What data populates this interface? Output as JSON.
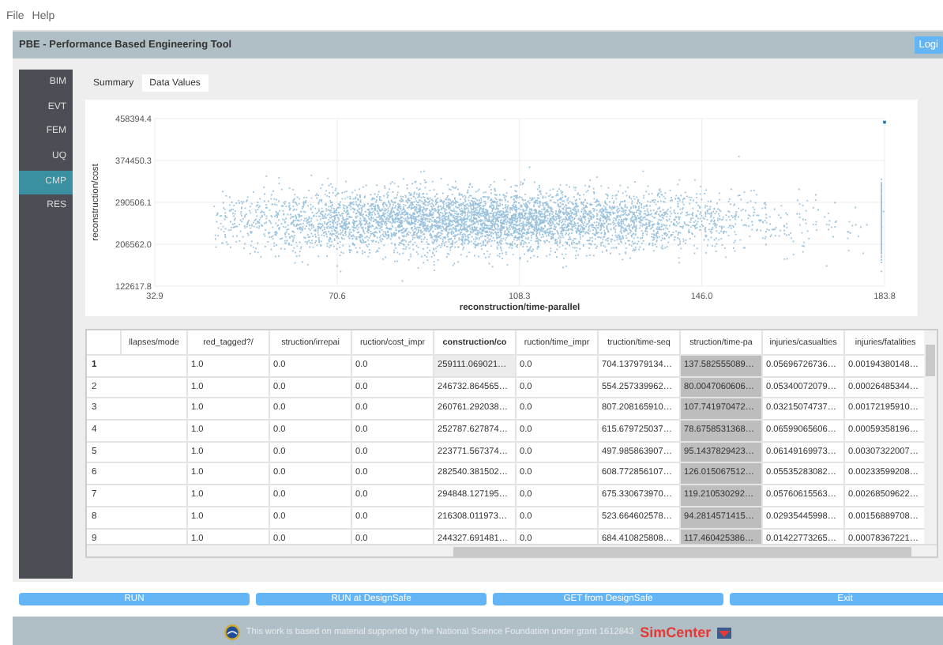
{
  "menu": [
    "File",
    "Help"
  ],
  "window": {
    "title": "PBE - Performance Based Engineering Tool",
    "login_button": "Logi"
  },
  "sidebar": {
    "items": [
      {
        "label": "BIM",
        "selected": false
      },
      {
        "label": "EVT",
        "selected": false
      },
      {
        "label": "FEM",
        "selected": false
      },
      {
        "label": "UQ",
        "selected": false
      },
      {
        "label": "CMP",
        "selected": true
      },
      {
        "label": "RES",
        "selected": false
      }
    ]
  },
  "tabs": [
    {
      "label": "Summary",
      "selected": false
    },
    {
      "label": "Data Values",
      "selected": true
    }
  ],
  "chart": {
    "chart_data": {
      "type": "scatter",
      "grid": true,
      "xlabel": "reconstruction/time-parallel",
      "ylabel": "reconstruction/cost",
      "xlim": [
        32.9,
        183.8
      ],
      "ylim": [
        122617.8,
        458394.4
      ],
      "xticks": [
        {
          "value": 32.9,
          "label": "32.9"
        },
        {
          "value": 70.6,
          "label": "70.6"
        },
        {
          "value": 108.3,
          "label": "108.3"
        },
        {
          "value": 146.0,
          "label": "146.0"
        },
        {
          "value": 183.8,
          "label": "183.8"
        }
      ],
      "yticks": [
        {
          "value": 122617.8,
          "label": "122617.8"
        },
        {
          "value": 206562.0,
          "label": "206562.0"
        },
        {
          "value": 290506.1,
          "label": "290506.1"
        },
        {
          "value": 374450.3,
          "label": "374450.3"
        },
        {
          "value": 458394.4,
          "label": "458394.4"
        }
      ]
    }
  },
  "table": {
    "columns": [
      {
        "label": "llapses/mode",
        "current": false,
        "selected": false
      },
      {
        "label": "red_tagged?/",
        "current": false,
        "selected": false
      },
      {
        "label": "struction/irrepai",
        "current": false,
        "selected": false
      },
      {
        "label": "ruction/cost_impr",
        "current": false,
        "selected": false
      },
      {
        "label": "construction/co",
        "current": true,
        "selected": false
      },
      {
        "label": "ruction/time_impr",
        "current": false,
        "selected": false
      },
      {
        "label": "truction/time-seq",
        "current": false,
        "selected": false
      },
      {
        "label": "struction/time-pa",
        "current": false,
        "selected": true
      },
      {
        "label": "injuries/casualties",
        "current": false,
        "selected": false
      },
      {
        "label": "injuries/fatalities",
        "current": false,
        "selected": false
      }
    ],
    "rows": [
      {
        "header": "1",
        "current": true,
        "cells": [
          "",
          "1.0",
          "0.0",
          "0.0",
          "259111.069021…",
          "0.0",
          "704.137979134…",
          "137.582555089…",
          "0.05696726736…",
          "0.00194380148…"
        ]
      },
      {
        "header": "2",
        "current": false,
        "cells": [
          "",
          "1.0",
          "0.0",
          "0.0",
          "246732.864565…",
          "0.0",
          "554.257339962…",
          "80.0047060606…",
          "0.05340072079…",
          "0.00026485344…"
        ]
      },
      {
        "header": "3",
        "current": false,
        "cells": [
          "",
          "1.0",
          "0.0",
          "0.0",
          "260761.292038…",
          "0.0",
          "807.208165910…",
          "107.741970472…",
          "0.03215074737…",
          "0.00172195910…"
        ]
      },
      {
        "header": "4",
        "current": false,
        "cells": [
          "",
          "1.0",
          "0.0",
          "0.0",
          "252787.627874…",
          "0.0",
          "615.679725037…",
          "78.6758531368…",
          "0.06599065606…",
          "0.00059358196…"
        ]
      },
      {
        "header": "5",
        "current": false,
        "cells": [
          "",
          "1.0",
          "0.0",
          "0.0",
          "223771.567374…",
          "0.0",
          "497.985863907…",
          "95.1437829423…",
          "0.06149169973…",
          "0.00307322007…"
        ]
      },
      {
        "header": "6",
        "current": false,
        "cells": [
          "",
          "1.0",
          "0.0",
          "0.0",
          "282540.381502…",
          "0.0",
          "608.772856107…",
          "126.015067512…",
          "0.05535283082…",
          "0.00233599208…"
        ]
      },
      {
        "header": "7",
        "current": false,
        "cells": [
          "",
          "1.0",
          "0.0",
          "0.0",
          "294848.127195…",
          "0.0",
          "675.330673970…",
          "119.210530292…",
          "0.05760615563…",
          "0.00268509622…"
        ]
      },
      {
        "header": "8",
        "current": false,
        "cells": [
          "",
          "1.0",
          "0.0",
          "0.0",
          "216308.011973…",
          "0.0",
          "523.664602578…",
          "94.2814571415…",
          "0.02935445998…",
          "0.00156889708…"
        ]
      },
      {
        "header": "9",
        "current": false,
        "cells": [
          "",
          "1.0",
          "0.0",
          "0.0",
          "244327.691481…",
          "0.0",
          "684.410825808…",
          "117.460425386…",
          "0.01422773265…",
          "0.00078367221…"
        ]
      }
    ]
  },
  "buttons": [
    "RUN",
    "RUN at DesignSafe",
    "GET from DesignSafe",
    "Exit"
  ],
  "footer": {
    "text": "This work is based on material supported by the National Science Foundation under grant 1612843",
    "logo": "SimCenter"
  }
}
